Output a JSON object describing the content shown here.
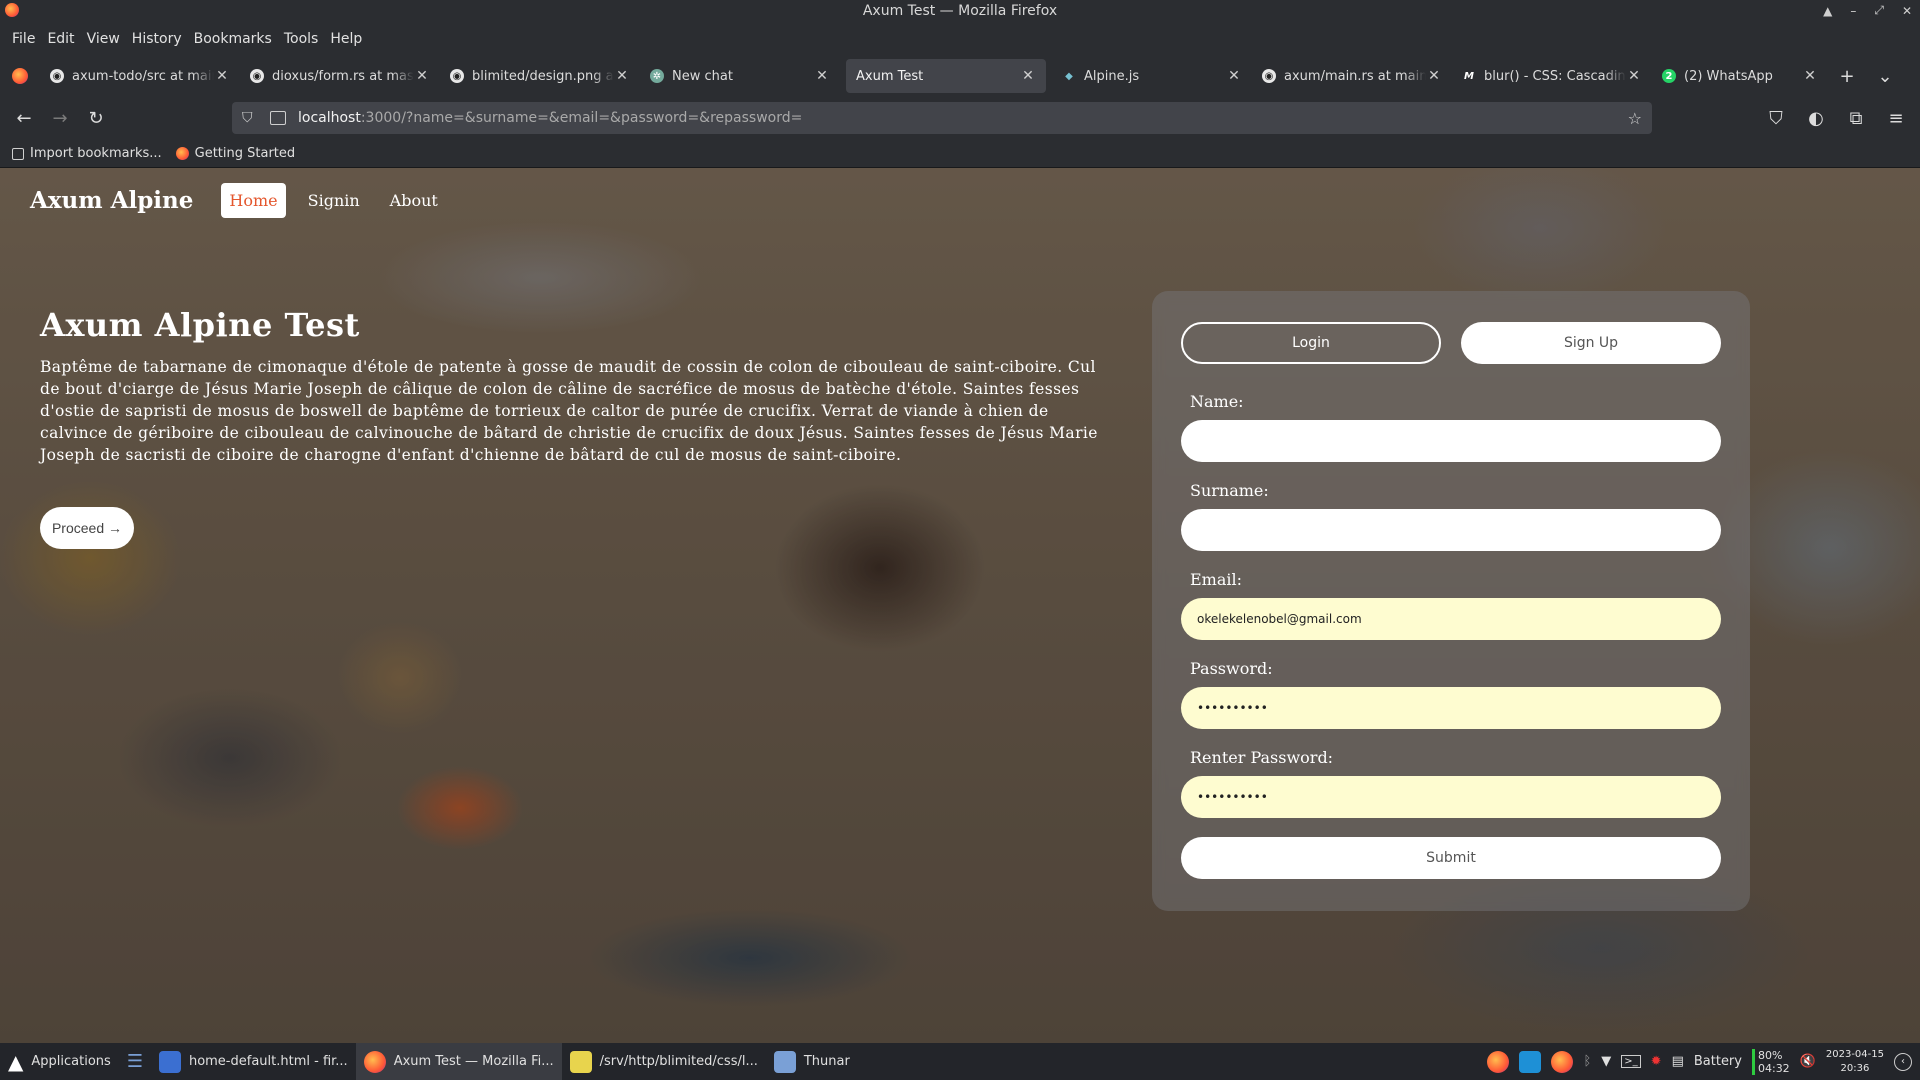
{
  "window": {
    "title": "Axum Test — Mozilla Firefox",
    "controls": [
      "▲",
      "–",
      "⤢",
      "✕"
    ]
  },
  "menu": [
    "File",
    "Edit",
    "View",
    "History",
    "Bookmarks",
    "Tools",
    "Help"
  ],
  "tabs": [
    {
      "title": "axum-todo/src at main",
      "icon": "github-icon",
      "glyph": "◉"
    },
    {
      "title": "dioxus/form.rs at master",
      "icon": "github-icon",
      "glyph": "◉"
    },
    {
      "title": "blimited/design.png at main",
      "icon": "github-icon",
      "glyph": "◉"
    },
    {
      "title": "New chat",
      "icon": "chatgpt-icon",
      "glyph": "✲"
    },
    {
      "title": "Axum Test",
      "icon": "",
      "glyph": ""
    },
    {
      "title": "Alpine.js",
      "icon": "alpine-icon",
      "glyph": "◆"
    },
    {
      "title": "axum/main.rs at main",
      "icon": "github-icon",
      "glyph": "◉"
    },
    {
      "title": "blur() - CSS: Cascading",
      "icon": "mdn-icon",
      "glyph": "M"
    },
    {
      "title": "(2) WhatsApp",
      "icon": "whatsapp-icon",
      "glyph": "2"
    }
  ],
  "tab_close": "✕",
  "new_tab": "+",
  "tab_list": "⌄",
  "nav": {
    "back": "←",
    "forward": "→",
    "reload": "↻",
    "url_host": "localhost",
    "url_rest": ":3000/?name=&surname=&email=&password=&repassword=",
    "star": "☆",
    "right_icons": [
      "⛉",
      "◐",
      "⧉",
      "≡"
    ]
  },
  "bookmarks": [
    {
      "label": "Import bookmarks...",
      "icon": "import-icon"
    },
    {
      "label": "Getting Started",
      "icon": "firefox-icon"
    }
  ],
  "site": {
    "brand": "Axum Alpine",
    "links": [
      "Home",
      "Signin",
      "About"
    ],
    "hero_title": "Axum Alpine Test",
    "hero_text": "Baptême de tabarnane de cimonaque d'étole de patente à gosse de maudit de cossin de colon de ciboulеau de saint-ciboire. Cul de bout d'ciarge de Jésus Marie Joseph de câlique de colon de câline de sacréfice de mosus de batèche d'étole. Saintes fesses d'ostie de sapristi de mosus de boswell de baptême de torrieux de caltor de purée de crucifix. Verrat de viande à chien de calvince de gériboire de ciboulеau de calvinouche de bâtard de christie de crucifix de doux Jésus. Saintes fesses de Jésus Marie Joseph de sacristi de ciboire de charogne d'enfant d'chienne de bâtard de cul de mosus de saint-ciboire.",
    "proceed": "Proceed →"
  },
  "form": {
    "login_label": "Login",
    "signup_label": "Sign Up",
    "fields": [
      {
        "label": "Name:",
        "value": ""
      },
      {
        "label": "Surname:",
        "value": ""
      },
      {
        "label": "Email:",
        "value": "okelekelenobel@gmail.com"
      },
      {
        "label": "Password:",
        "value": "••••••••••"
      },
      {
        "label": "Renter Password:",
        "value": "••••••••••"
      }
    ],
    "submit_label": "Submit"
  },
  "taskbar": {
    "apps_label": "Applications",
    "items": [
      {
        "label": "home-default.html - fir...",
        "icon": "text-editor-icon",
        "color": "#3b6fd1"
      },
      {
        "label": "Axum Test — Mozilla Fi...",
        "icon": "firefox-icon",
        "color": "#ff6a36"
      },
      {
        "label": "/srv/http/blimited/css/l...",
        "icon": "notes-icon",
        "color": "#e8d44d"
      },
      {
        "label": "Thunar",
        "icon": "folder-icon",
        "color": "#7aa0d6"
      }
    ],
    "battery_label": "Battery",
    "battery_pct": "80%",
    "battery_time": "04:32",
    "date": "2023-04-15",
    "time": "20:36"
  }
}
